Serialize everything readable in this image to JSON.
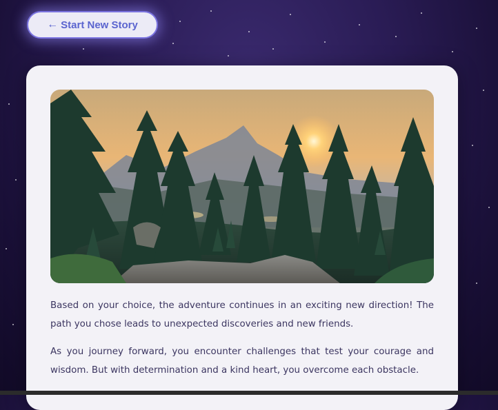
{
  "nav": {
    "back_arrow": "←",
    "back_label": "Start New Story"
  },
  "story": {
    "image_icon": "forest-sunset-scene",
    "paragraphs": [
      "Based on your choice, the adventure continues in an exciting new direction! The path you chose leads to unexpected discoveries and new friends.",
      "As you journey forward, you encounter challenges that test your courage and wisdom. But with determination and a kind heart, you overcome each obstacle."
    ]
  },
  "colors": {
    "accent": "#5a64cf",
    "button_border": "#7b74e0",
    "card_bg": "#f3f2f7",
    "text": "#3b3560",
    "background": "#2a1c55"
  }
}
